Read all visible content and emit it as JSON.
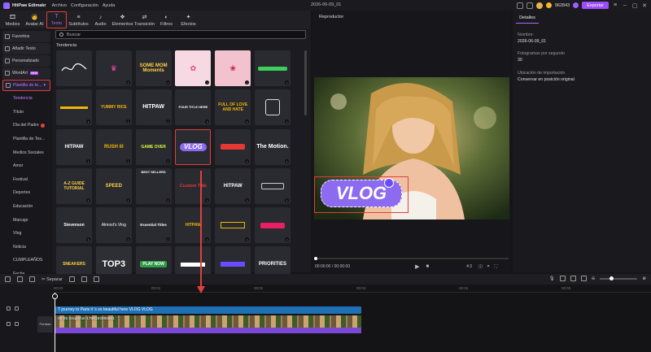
{
  "titlebar": {
    "app_name": "HitPaw Edimakr",
    "menus": [
      "Archivo",
      "Configuración",
      "Ayuda"
    ],
    "project_name": "2026-06-09_01",
    "points": "962843",
    "export_label": "Exportar"
  },
  "tabs": [
    {
      "label": "Medios",
      "icon": "🎞"
    },
    {
      "label": "Avatar AI",
      "icon": "🧑"
    },
    {
      "label": "Texto",
      "icon": "T"
    },
    {
      "label": "Subtítulos",
      "icon": "≡"
    },
    {
      "label": "Audio",
      "icon": "♪"
    },
    {
      "label": "Elementos",
      "icon": "❖"
    },
    {
      "label": "Transición",
      "icon": "⇄"
    },
    {
      "label": "Filtros",
      "icon": "◐"
    },
    {
      "label": "Efectos",
      "icon": "✦"
    }
  ],
  "sidemenu": {
    "top_items": [
      "Favoritos",
      "Añadir Texto",
      "Personalizado",
      "WordArt",
      "Plantilla de te..."
    ],
    "new_badge": "NEW",
    "categories": [
      "Tendencia",
      "Título",
      "Día del Padre",
      "Plantilla de Tex...",
      "Medios Sociales",
      "Amor",
      "Festival",
      "Deportes",
      "Educación",
      "Marcaje",
      "Vlog",
      "Noticia",
      "CUMPLEAÑOS",
      "Fecha"
    ]
  },
  "content": {
    "search_placeholder": "Buscar",
    "section_title": "Tendencia",
    "templates": [
      "",
      "",
      "SOME MOM Moments",
      "",
      "",
      "",
      "",
      "YUMMY RICE",
      "HITPAW",
      "FOUR TITLE HERE",
      "FULL OF LOVE AND HATE",
      "",
      "HITPAW",
      "RUSH III",
      "GAME OVER",
      "VLOG",
      "",
      "The Motion.",
      "A-Z GUIDE TUTORIAL",
      "SPEED",
      "BEST SELLERS",
      "Custom Title",
      "HITPAW",
      "",
      "Stevenson",
      "Almost's Vlog",
      "Essential Titles",
      "HITPAW",
      "",
      "",
      "SNEAKERS",
      "TOP3",
      "PLAY NOW",
      "",
      "",
      "PRIORITIES"
    ]
  },
  "player": {
    "title": "Reproductor",
    "time": "00:00:00 / 00:00:00",
    "aspect": "4:3",
    "overlay_text": "VLOG"
  },
  "details": {
    "tab": "Detalles",
    "name_label": "Nombre:",
    "name_value": "2026-06-09_01",
    "fps_label": "Fotogramas por segundo",
    "fps_value": "30",
    "import_label": "Ubicación de importación",
    "import_value": "Conservar en posición original"
  },
  "timeline": {
    "split_label": "Separar",
    "ruler": [
      "00:00",
      "00:01",
      "00:02",
      "00:03",
      "00:04",
      "00:05"
    ],
    "text_clip": "journey to Paris it 's so beautiful here  VLOG VLOG",
    "video_clip": "00:05  Snapshot-1759193396541",
    "cover_label": "Portada"
  }
}
